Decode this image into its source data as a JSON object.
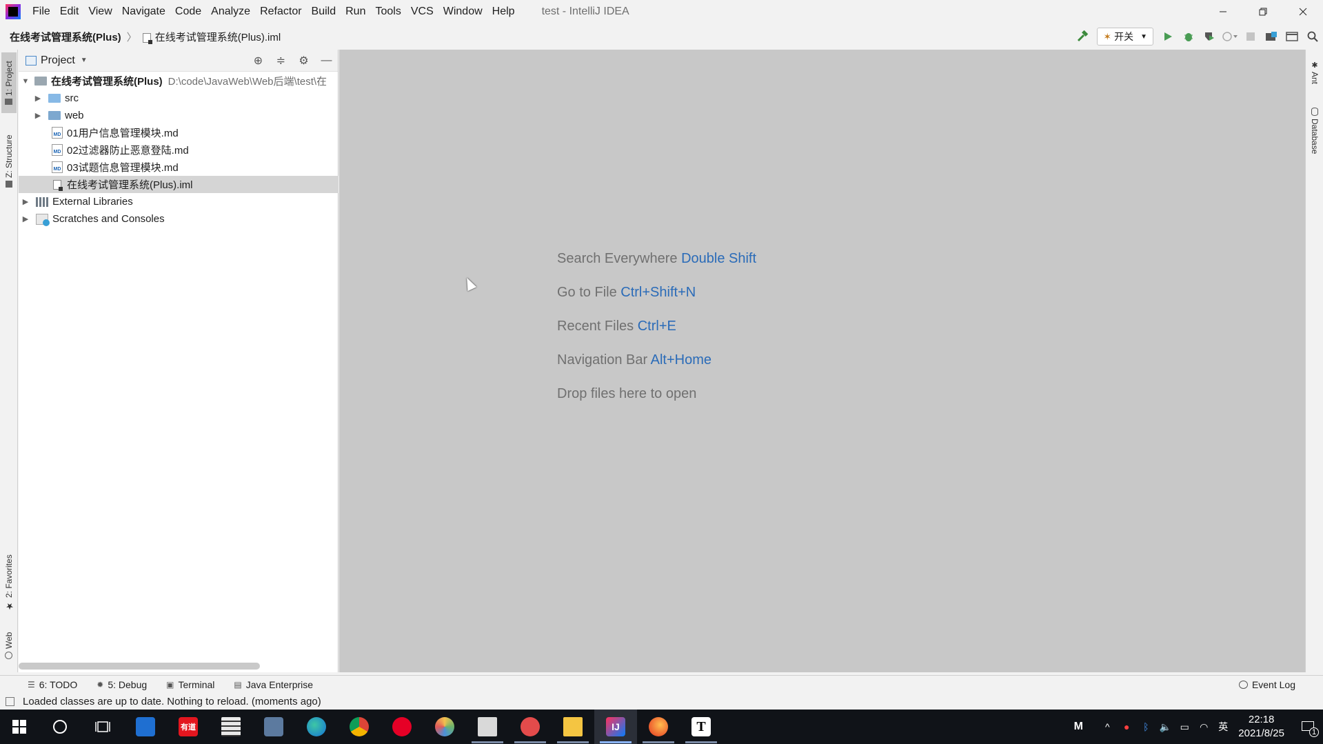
{
  "menu": {
    "items": [
      "File",
      "Edit",
      "View",
      "Navigate",
      "Code",
      "Analyze",
      "Refactor",
      "Build",
      "Run",
      "Tools",
      "VCS",
      "Window",
      "Help"
    ],
    "window_title": "test - IntelliJ IDEA"
  },
  "navbar": {
    "root": "在线考试管理系统(Plus)",
    "separator": "〉",
    "file": "在线考试管理系统(Plus).iml"
  },
  "toolbar": {
    "run_config": "开关"
  },
  "left_stripe": {
    "project": "1: Project",
    "structure": "Z: Structure",
    "favorites": "2: Favorites",
    "web": "Web"
  },
  "right_stripe": {
    "ant": "Ant",
    "database": "Database"
  },
  "project_panel": {
    "title": "Project",
    "root_name": "在线考试管理系统(Plus)",
    "root_path": "D:\\code\\JavaWeb\\Web后端\\test\\在",
    "items": [
      "src",
      "web",
      "01用户信息管理模块.md",
      "02过滤器防止恶意登陆.md",
      "03试题信息管理模块.md",
      "在线考试管理系统(Plus).iml"
    ],
    "external_libraries": "External Libraries",
    "scratches": "Scratches and Consoles",
    "md_badge": "MD"
  },
  "editor_hints": [
    {
      "text": "Search Everywhere",
      "key": "Double Shift"
    },
    {
      "text": "Go to File",
      "key": "Ctrl+Shift+N"
    },
    {
      "text": "Recent Files",
      "key": "Ctrl+E"
    },
    {
      "text": "Navigation Bar",
      "key": "Alt+Home"
    },
    {
      "text": "Drop files here to open",
      "key": ""
    }
  ],
  "tool_tabs": {
    "todo": "6: TODO",
    "debug": "5: Debug",
    "terminal": "Terminal",
    "java_enterprise": "Java Enterprise",
    "event_log": "Event Log"
  },
  "status": {
    "message": "Loaded classes are up to date. Nothing to reload. (moments ago)"
  },
  "taskbar": {
    "youdao_label": "有道",
    "intellij_label": "IJ",
    "typora_label": "T",
    "tray_m": "M",
    "ime": "英",
    "time": "22:18",
    "date": "2021/8/25",
    "notification_count": "1"
  }
}
